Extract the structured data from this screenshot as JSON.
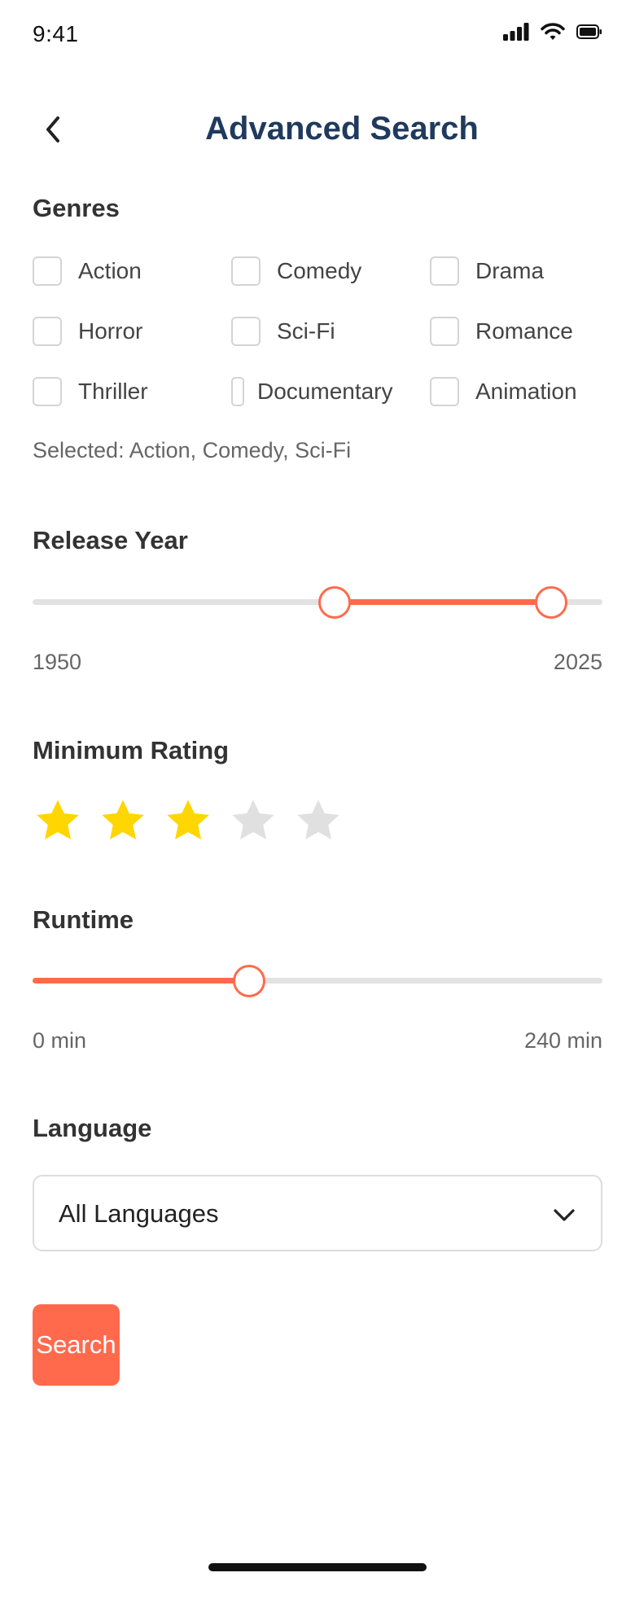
{
  "status_bar": {
    "time": "9:41"
  },
  "header": {
    "title": "Advanced Search"
  },
  "genres": {
    "title": "Genres",
    "items": [
      "Action",
      "Comedy",
      "Drama",
      "Horror",
      "Sci-Fi",
      "Romance",
      "Thriller",
      "Documentary",
      "Animation"
    ],
    "selected_text": "Selected: Action, Comedy, Sci-Fi"
  },
  "release_year": {
    "title": "Release Year",
    "min_label": "1950",
    "max_label": "2025",
    "range_min": 1950,
    "range_max": 2025,
    "selected_low_fraction": 0.53,
    "selected_high_fraction": 0.91
  },
  "minimum_rating": {
    "title": "Minimum Rating",
    "value": 3,
    "max": 5
  },
  "runtime": {
    "title": "Runtime",
    "min_label": "0 min",
    "max_label": "240 min",
    "value_fraction": 0.38
  },
  "language": {
    "title": "Language",
    "selected": "All Languages"
  },
  "search_button": {
    "label": "Search"
  },
  "colors": {
    "accent": "#ff6a4d",
    "title": "#1f3a5c",
    "star_filled": "#ffd600",
    "star_empty": "#e0e0e0",
    "track": "#e2e2e2"
  },
  "icons": {
    "back": "chevron-left-icon",
    "dropdown": "chevron-down-icon",
    "signal": "cellular-signal-icon",
    "wifi": "wifi-icon",
    "battery": "battery-icon",
    "star": "star-icon"
  }
}
